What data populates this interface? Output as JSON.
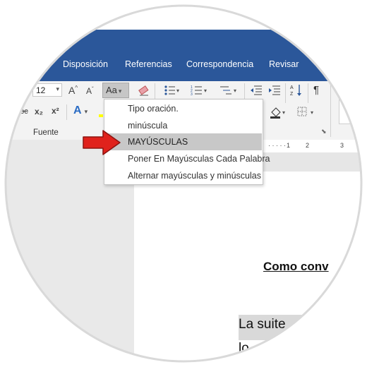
{
  "ribbon_tabs": [
    "Disposición",
    "Referencias",
    "Correspondencia",
    "Revisar"
  ],
  "font": {
    "size_value": "12",
    "grow_label": "A",
    "shrink_label": "A",
    "change_case_label": "Aa",
    "strikethrough_label": "abc",
    "subscript_label": "x₂",
    "superscript_label": "x²",
    "text_effects_label": "A",
    "group_label": "Fuente"
  },
  "paragraph": {
    "pilcrow_label": "¶"
  },
  "change_case_menu": {
    "items": [
      {
        "label": "Tipo oración."
      },
      {
        "label": "minúscula"
      },
      {
        "label": "MAYÚSCULAS"
      },
      {
        "label": "Poner En Mayúsculas Cada Palabra"
      },
      {
        "label": "Alternar mayúsculas y minúsculas"
      }
    ],
    "selected_index": 2
  },
  "ruler": {
    "numbers": [
      "1",
      "2",
      "3"
    ]
  },
  "document": {
    "title": "Como conv",
    "line1": "La suite",
    "line2": "lo"
  },
  "colors": {
    "ribbon_blue": "#2b579a",
    "arrow_red": "#e0221c",
    "menu_selected": "#c8c8c8"
  },
  "icons": [
    "eraser-icon",
    "bullets-icon",
    "numbering-icon",
    "multilevel-list-icon",
    "decrease-indent-icon",
    "increase-indent-icon",
    "sort-icon",
    "shading-icon",
    "borders-icon",
    "pointer-arrow-icon"
  ]
}
